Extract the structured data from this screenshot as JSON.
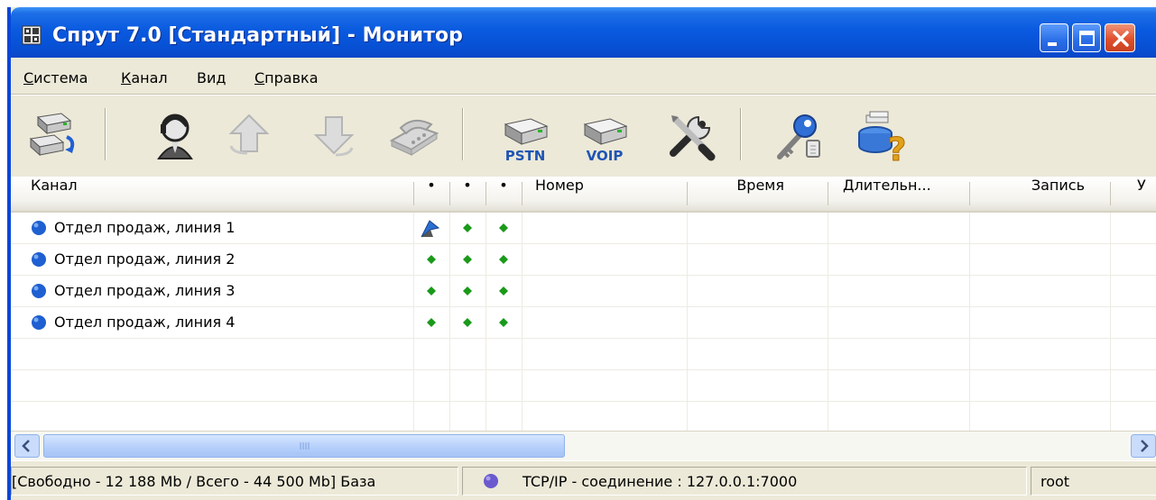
{
  "window": {
    "title": "Спрут 7.0 [Стандартный] - Монитор",
    "app_icon": "grid-app-icon",
    "controls": [
      "minimize-icon",
      "maximize-icon",
      "close-icon"
    ]
  },
  "menu": {
    "items": [
      {
        "label": "Система",
        "hotkey": "С"
      },
      {
        "label": "Канал",
        "hotkey": "К"
      },
      {
        "label": "Вид",
        "hotkey": ""
      },
      {
        "label": "Справка",
        "hotkey": "С"
      }
    ]
  },
  "toolbar": {
    "buttons": [
      {
        "icon": "channel-refresh-icon"
      },
      {
        "icon": "operator-headset-icon"
      },
      {
        "icon": "arrow-up-icon"
      },
      {
        "icon": "arrow-down-icon"
      },
      {
        "icon": "telephone-icon"
      },
      {
        "icon": "pstn-device-icon",
        "label": "PSTN"
      },
      {
        "icon": "voip-device-icon",
        "label": "VOIP"
      },
      {
        "icon": "tools-icon"
      },
      {
        "icon": "keys-icon"
      },
      {
        "icon": "help-database-icon"
      }
    ]
  },
  "table": {
    "columns": [
      "Канал",
      "•",
      "•",
      "•",
      "Номер",
      "Время",
      "Длительн...",
      "Запись",
      "У"
    ],
    "rows": [
      {
        "channel": "Отдел продаж, линия 1",
        "status_color": "#1e5fd1",
        "indicators": [
          "flag-icon",
          "green-dot-icon",
          "green-dot-icon"
        ],
        "number": "",
        "time": "",
        "duration": "",
        "record": ""
      },
      {
        "channel": "Отдел продаж, линия 2",
        "status_color": "#1e5fd1",
        "indicators": [
          "green-dot-icon",
          "green-dot-icon",
          "green-dot-icon"
        ],
        "number": "",
        "time": "",
        "duration": "",
        "record": ""
      },
      {
        "channel": "Отдел продаж, линия 3",
        "status_color": "#1e5fd1",
        "indicators": [
          "green-dot-icon",
          "green-dot-icon",
          "green-dot-icon"
        ],
        "number": "",
        "time": "",
        "duration": "",
        "record": ""
      },
      {
        "channel": "Отдел продаж, линия 4",
        "status_color": "#1e5fd1",
        "indicators": [
          "green-dot-icon",
          "green-dot-icon",
          "green-dot-icon"
        ],
        "number": "",
        "time": "",
        "duration": "",
        "record": ""
      }
    ],
    "indicator_color": "#1a9a1a"
  },
  "status": {
    "disk": "[Свободно - 12 188  Mb / Всего - 44 500  Mb] База",
    "connection_color": "#6a5acd",
    "connection": "TCP/IP - соединение : 127.0.0.1:7000",
    "user": "root"
  },
  "colors": {
    "titlebar": "#0a5ae0",
    "chrome": "#ece9d8",
    "scroll_thumb": "#b6d0fb"
  }
}
